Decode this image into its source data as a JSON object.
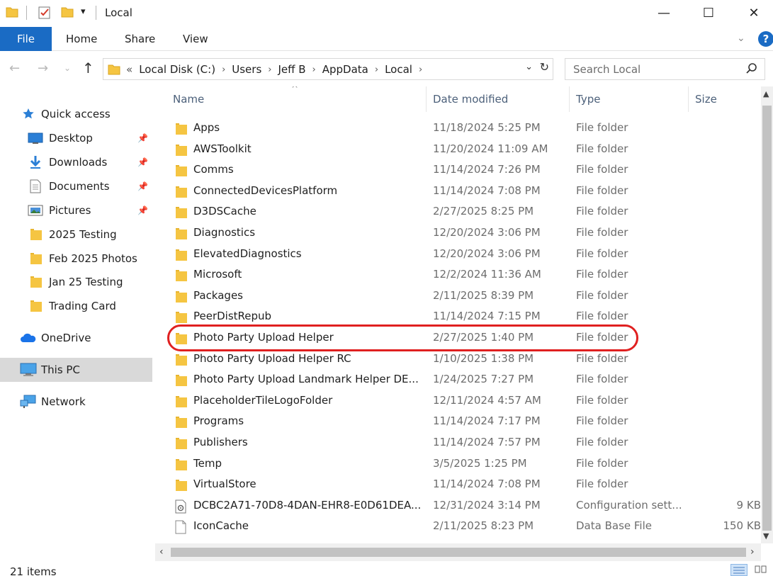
{
  "window": {
    "title": "Local",
    "minimize": "—",
    "maximize": "☐",
    "close": "✕"
  },
  "ribbon": {
    "tabs": [
      "File",
      "Home",
      "Share",
      "View"
    ]
  },
  "address": {
    "overflow": "«",
    "crumbs": [
      "Local Disk (C:)",
      "Users",
      "Jeff B",
      "AppData",
      "Local"
    ],
    "dropdown": "⌄",
    "refresh": "↻"
  },
  "search": {
    "placeholder": "Search Local"
  },
  "sidebar": {
    "items": [
      {
        "label": "Quick access",
        "icon": "star-icon",
        "pinned": false
      },
      {
        "label": "Desktop",
        "icon": "desktop-icon",
        "pinned": true
      },
      {
        "label": "Downloads",
        "icon": "download-icon",
        "pinned": true
      },
      {
        "label": "Documents",
        "icon": "document-icon",
        "pinned": true
      },
      {
        "label": "Pictures",
        "icon": "pictures-icon",
        "pinned": true
      },
      {
        "label": "2025 Testing",
        "icon": "folder-icon",
        "pinned": false
      },
      {
        "label": "Feb 2025 Photos",
        "icon": "folder-icon",
        "pinned": false
      },
      {
        "label": "Jan 25 Testing",
        "icon": "folder-icon",
        "pinned": false
      },
      {
        "label": "Trading Card",
        "icon": "folder-icon",
        "pinned": false
      },
      {
        "label": "OneDrive",
        "icon": "cloud-icon",
        "pinned": false
      },
      {
        "label": "This PC",
        "icon": "computer-icon",
        "pinned": false
      },
      {
        "label": "Network",
        "icon": "network-icon",
        "pinned": false
      }
    ]
  },
  "columns": {
    "name": "Name",
    "date": "Date modified",
    "type": "Type",
    "size": "Size"
  },
  "files": [
    {
      "name": "Apps",
      "date": "11/18/2024 5:25 PM",
      "type": "File folder",
      "size": "",
      "icon": "folder-icon"
    },
    {
      "name": "AWSToolkit",
      "date": "11/20/2024 11:09 AM",
      "type": "File folder",
      "size": "",
      "icon": "folder-icon"
    },
    {
      "name": "Comms",
      "date": "11/14/2024 7:26 PM",
      "type": "File folder",
      "size": "",
      "icon": "folder-icon"
    },
    {
      "name": "ConnectedDevicesPlatform",
      "date": "11/14/2024 7:08 PM",
      "type": "File folder",
      "size": "",
      "icon": "folder-icon"
    },
    {
      "name": "D3DSCache",
      "date": "2/27/2025 8:25 PM",
      "type": "File folder",
      "size": "",
      "icon": "folder-icon"
    },
    {
      "name": "Diagnostics",
      "date": "12/20/2024 3:06 PM",
      "type": "File folder",
      "size": "",
      "icon": "folder-icon"
    },
    {
      "name": "ElevatedDiagnostics",
      "date": "12/20/2024 3:06 PM",
      "type": "File folder",
      "size": "",
      "icon": "folder-icon"
    },
    {
      "name": "Microsoft",
      "date": "12/2/2024 11:36 AM",
      "type": "File folder",
      "size": "",
      "icon": "folder-icon"
    },
    {
      "name": "Packages",
      "date": "2/11/2025 8:39 PM",
      "type": "File folder",
      "size": "",
      "icon": "folder-icon"
    },
    {
      "name": "PeerDistRepub",
      "date": "11/14/2024 7:15 PM",
      "type": "File folder",
      "size": "",
      "icon": "folder-icon"
    },
    {
      "name": "Photo Party Upload Helper",
      "date": "2/27/2025 1:40 PM",
      "type": "File folder",
      "size": "",
      "icon": "folder-icon"
    },
    {
      "name": "Photo Party Upload Helper RC",
      "date": "1/10/2025 1:38 PM",
      "type": "File folder",
      "size": "",
      "icon": "folder-icon"
    },
    {
      "name": "Photo Party Upload Landmark Helper DE...",
      "date": "1/24/2025 7:27 PM",
      "type": "File folder",
      "size": "",
      "icon": "folder-icon"
    },
    {
      "name": "PlaceholderTileLogoFolder",
      "date": "12/11/2024 4:57 AM",
      "type": "File folder",
      "size": "",
      "icon": "folder-icon"
    },
    {
      "name": "Programs",
      "date": "11/14/2024 7:17 PM",
      "type": "File folder",
      "size": "",
      "icon": "folder-icon"
    },
    {
      "name": "Publishers",
      "date": "11/14/2024 7:57 PM",
      "type": "File folder",
      "size": "",
      "icon": "folder-icon"
    },
    {
      "name": "Temp",
      "date": "3/5/2025 1:25 PM",
      "type": "File folder",
      "size": "",
      "icon": "folder-icon"
    },
    {
      "name": "VirtualStore",
      "date": "11/14/2024 7:08 PM",
      "type": "File folder",
      "size": "",
      "icon": "folder-icon"
    },
    {
      "name": "DCBC2A71-70D8-4DAN-EHR8-E0D61DEA...",
      "date": "12/31/2024 3:14 PM",
      "type": "Configuration sett...",
      "size": "9 KB",
      "icon": "config-file-icon"
    },
    {
      "name": "IconCache",
      "date": "2/11/2025 8:23 PM",
      "type": "Data Base File",
      "size": "150 KB",
      "icon": "file-icon"
    }
  ],
  "highlighted_file": "Photo Party Upload Helper",
  "status": {
    "count": "21 items"
  },
  "colors": {
    "accent": "#1a6bc4",
    "folder": "#f5c542",
    "highlight_ring": "#e02020"
  }
}
